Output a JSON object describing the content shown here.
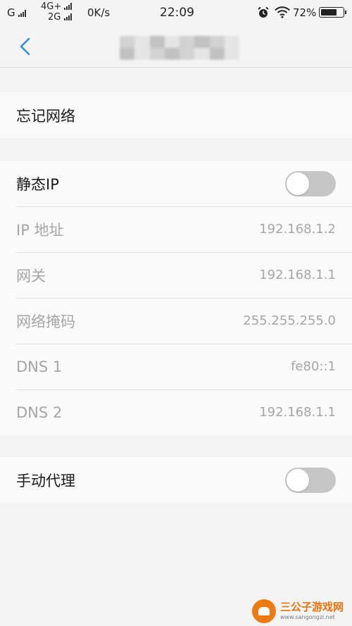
{
  "status_bar": {
    "carrier_left": "G",
    "network_top": "4G+",
    "network_bottom": "2G",
    "speed": "0K/s",
    "time": "22:09",
    "battery": "72%",
    "battery_level": 0.72,
    "icons": [
      "signal-icon",
      "alarm-icon",
      "wifi-icon",
      "battery-icon"
    ]
  },
  "nav": {
    "back_icon": "chevron-left-icon",
    "accent": "#2a8ce0"
  },
  "forget_network": {
    "label": "忘记网络"
  },
  "ip_settings": {
    "static_ip": {
      "label": "静态IP",
      "enabled": false
    },
    "rows": [
      {
        "label": "IP 地址",
        "value": "192.168.1.2"
      },
      {
        "label": "网关",
        "value": "192.168.1.1"
      },
      {
        "label": "网络掩码",
        "value": "255.255.255.0"
      },
      {
        "label": "DNS 1",
        "value": "fe80::1"
      },
      {
        "label": "DNS 2",
        "value": "192.168.1.1"
      }
    ]
  },
  "proxy": {
    "label": "手动代理",
    "enabled": false
  },
  "watermark": {
    "title": "三公子游戏网",
    "url": "www.sangongzi.net"
  }
}
